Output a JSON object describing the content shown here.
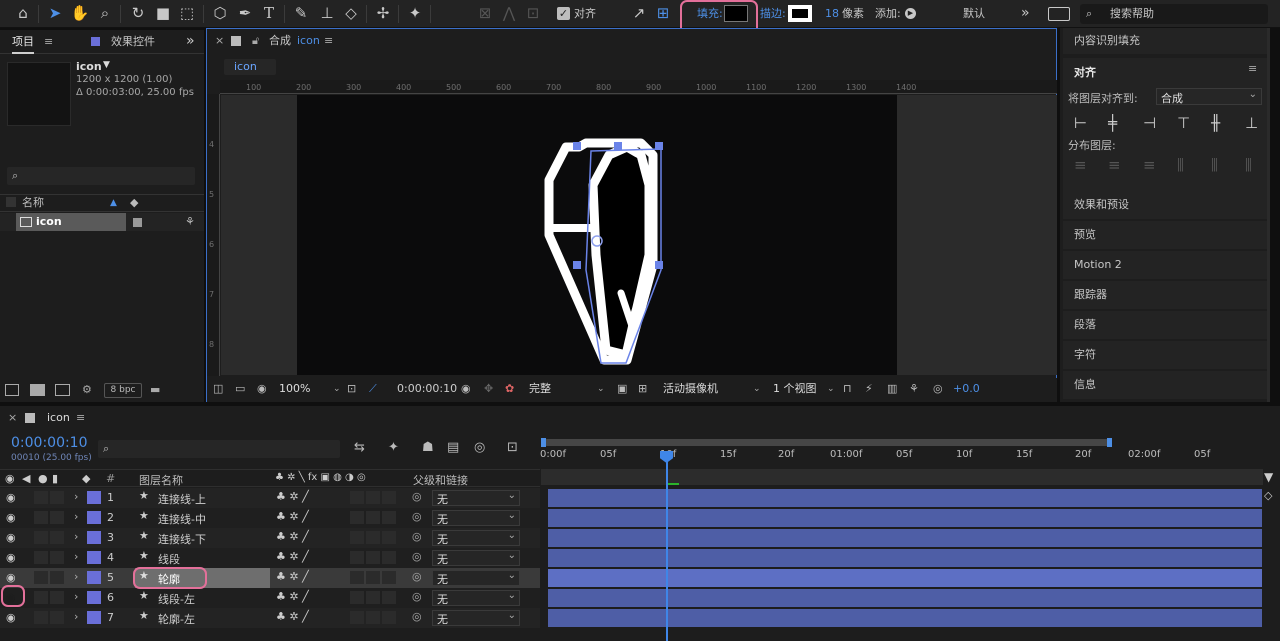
{
  "toolbar": {
    "align_checkbox_label": "对齐",
    "fill_label": "填充:",
    "stroke_label": "描边:",
    "stroke_width": "18",
    "stroke_unit": "像素",
    "add_label": "添加:",
    "workspace": "默认",
    "search_placeholder": "搜索帮助",
    "fill_color": "#000000"
  },
  "project_panel": {
    "tab_project": "项目",
    "tab_effects": "效果控件",
    "item_name": "icon",
    "item_dims": "1200 x 1200 (1.00)",
    "item_duration": "Δ 0:00:03:00, 25.00 fps",
    "col_name": "名称",
    "row_name": "icon",
    "bpc": "8 bpc"
  },
  "comp_panel": {
    "tab_prefix": "合成",
    "tab_name": "icon",
    "breadcrumb": "icon",
    "ruler_ticks": [
      "100",
      "200",
      "300",
      "400",
      "500",
      "600",
      "700",
      "800",
      "900",
      "1000",
      "1100",
      "1200",
      "1300",
      "1400"
    ],
    "vruler_ticks": [
      "4",
      "5",
      "6",
      "7",
      "8"
    ],
    "zoom": "100%",
    "timecode": "0:00:00:10",
    "quality": "完整",
    "camera": "活动摄像机",
    "views": "1 个视图",
    "exposure": "+0.0"
  },
  "right_panel": {
    "content_aware": "内容识别填充",
    "align_title": "对齐",
    "align_to_label": "将图层对齐到:",
    "align_to_value": "合成",
    "distribute_label": "分布图层:",
    "items": [
      "效果和预设",
      "预览",
      "Motion 2",
      "跟踪器",
      "段落",
      "字符",
      "信息"
    ]
  },
  "timeline": {
    "tab_name": "icon",
    "timecode": "0:00:00:10",
    "timecode_sub": "00010 (25.00 fps)",
    "col_hash": "#",
    "col_layer_name": "图层名称",
    "col_parent": "父级和链接",
    "time_markers": [
      "0:00f",
      "05f",
      "10f",
      "15f",
      "20f",
      "01:00f",
      "05f",
      "10f",
      "15f",
      "20f",
      "02:00f",
      "05f"
    ],
    "layers": [
      {
        "num": "1",
        "name": "连接线-上",
        "parent": "无"
      },
      {
        "num": "2",
        "name": "连接线-中",
        "parent": "无"
      },
      {
        "num": "3",
        "name": "连接线-下",
        "parent": "无"
      },
      {
        "num": "4",
        "name": "线段",
        "parent": "无"
      },
      {
        "num": "5",
        "name": "轮廓",
        "parent": "无"
      },
      {
        "num": "6",
        "name": "线段-左",
        "parent": "无"
      },
      {
        "num": "7",
        "name": "轮廓-左",
        "parent": "无"
      }
    ]
  },
  "colors": {
    "accent": "#4d8fe6",
    "highlight": "#e3709a",
    "layer_label": "#6a6fd8",
    "layer_bar": "#4e5ea6",
    "layer_bar_selected": "#5d6fc4"
  }
}
